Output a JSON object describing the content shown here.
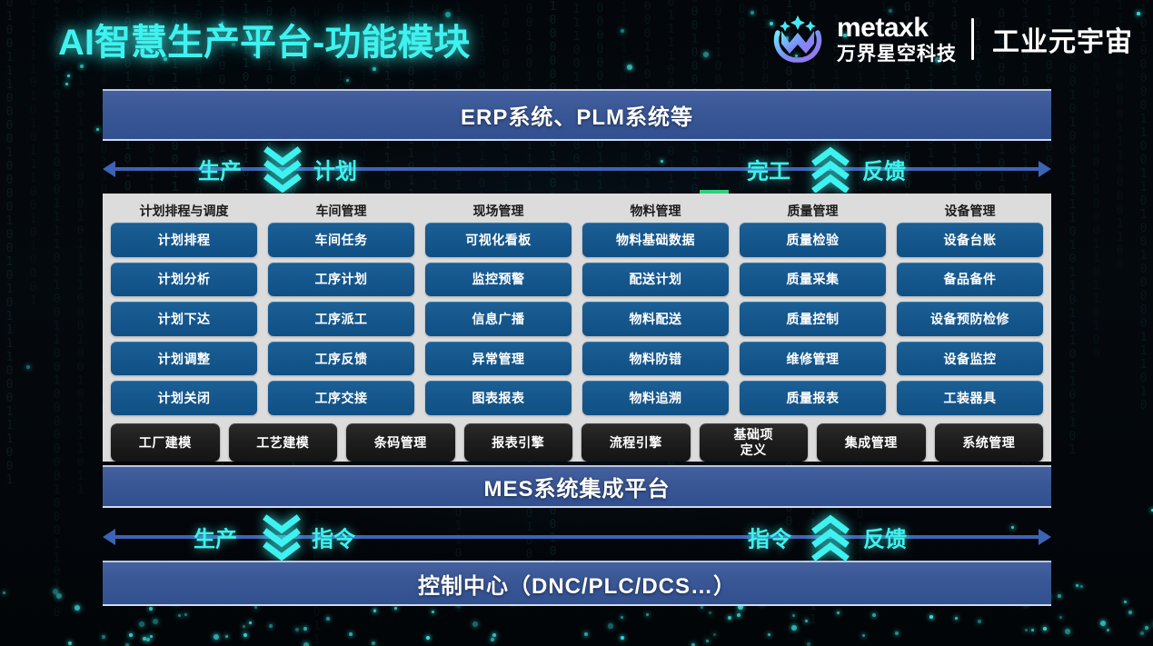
{
  "header": {
    "title": "AI智慧生产平台-功能模块",
    "brand": {
      "name_en": "metaxk",
      "name_cn": "万界星空科技",
      "tagline": "工业元宇宙"
    }
  },
  "bars": {
    "erp": "ERP系统、PLM系统等",
    "mes": "MES系统集成平台",
    "control": "控制中心（DNC/PLC/DCS…）"
  },
  "flows": {
    "top": {
      "left_label_1": "生产",
      "left_label_2": "计划",
      "right_label_1": "完工",
      "right_label_2": "反馈",
      "left_direction": "down",
      "right_direction": "up"
    },
    "bottom": {
      "left_label_1": "生产",
      "left_label_2": "指令",
      "right_label_1": "指令",
      "right_label_2": "反馈",
      "left_direction": "down",
      "right_direction": "up"
    }
  },
  "modules": {
    "columns": [
      {
        "header": "计划排程与调度",
        "items": [
          "计划排程",
          "计划分析",
          "计划下达",
          "计划调整",
          "计划关闭"
        ]
      },
      {
        "header": "车间管理",
        "items": [
          "车间任务",
          "工序计划",
          "工序派工",
          "工序反馈",
          "工序交接"
        ]
      },
      {
        "header": "现场管理",
        "items": [
          "可视化看板",
          "监控预警",
          "信息广播",
          "异常管理",
          "图表报表"
        ]
      },
      {
        "header": "物料管理",
        "items": [
          "物料基础数据",
          "配送计划",
          "物料配送",
          "物料防错",
          "物料追溯"
        ]
      },
      {
        "header": "质量管理",
        "items": [
          "质量检验",
          "质量采集",
          "质量控制",
          "维修管理",
          "质量报表"
        ]
      },
      {
        "header": "设备管理",
        "items": [
          "设备台账",
          "备品备件",
          "设备预防检修",
          "设备监控",
          "工装器具"
        ]
      }
    ],
    "platform_services": [
      "工厂建模",
      "工艺建模",
      "条码管理",
      "报表引擎",
      "流程引擎",
      "基础项\n定义",
      "集成管理",
      "系统管理"
    ]
  },
  "colors": {
    "accent_cyan": "#3ef2ef",
    "bar_blue": "#3a5796",
    "cell_blue": "#15578d",
    "panel_gray": "#dcdcdc",
    "black_cell": "#1d1d1d",
    "green_mark": "#2fd07a",
    "arrow_blue": "#3d63b4"
  }
}
